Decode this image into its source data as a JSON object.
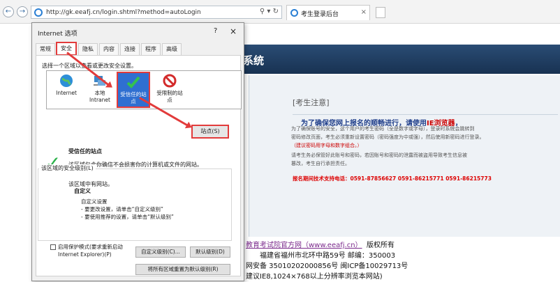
{
  "browser": {
    "url": "http://gk.eeafj.cn/login.shtml?method=autoLogin",
    "tools": "⚲ ▾ ↻",
    "tab_title": "考生登录后台",
    "back": "←",
    "forward": "→",
    "close": "×"
  },
  "page": {
    "header_title": "系统",
    "notice_title": "[考生注意]",
    "notice_head_prefix": "为了确保您网上报名的顺畅进行，请使用",
    "notice_head_hl": "IE浏览器",
    "notice_head_suffix": "，",
    "notice_lines": [
      "为了确保账号的安全，这个用户的考生密码（全是数字或字母），登录时系统会跳转到",
      "密码修改页面，考生必须重新设置密码（密码强度为中或强），然后使用新密码进行登录。",
      "（建议密码用字母和数字组合。）",
      "请考生务必保管好此账号和密码，若因账号和密码的泄露而被盗用导致考生信息被",
      "篡改，考生自行承担责任。"
    ],
    "support": "报名期间技术支持电话：0591-87856627   0591-86215771   0591-86215773",
    "footer_link": "教育考试院官方网（www.eeafj.cn）",
    "footer_rights": "版权所有",
    "footer_address": "福建省福州市北环中路59号  邮编：350003",
    "footer_icp": "网安备  35010202000856号 闽ICP备10029713号",
    "footer_tip": "建议IE8,1024×768以上分辨率浏览本网站)"
  },
  "dialog": {
    "title": "Internet 选项",
    "help": "?",
    "close": "×",
    "tabs": [
      "常规",
      "安全",
      "隐私",
      "内容",
      "连接",
      "程序",
      "高级"
    ],
    "active_tab": "安全",
    "select_zone_label": "选择一个区域以查看或更改安全设置。",
    "zones": [
      {
        "label": "Internet",
        "icon": "globe-icon"
      },
      {
        "label": "本地\nIntranet",
        "icon": "intranet-icon"
      },
      {
        "label": "受信任的站\n点",
        "icon": "check-icon"
      },
      {
        "label": "受限制的站\n点",
        "icon": "restricted-icon"
      }
    ],
    "selected_zone": "受信任的站点",
    "zone_name": "受信任的站点",
    "zone_desc": "该区域包含你确信不会损害你的计算机或文件的网站。",
    "zone_empty": "该区域中有网站。",
    "sites_button": "站点(S)",
    "level_group_title": "该区域的安全级别(L)",
    "custom_title": "自定义",
    "custom_lines": [
      "自定义设置",
      "- 要更改设置，请单击“自定义级别”",
      "- 要使用推荐的设置，请单击“默认级别”"
    ],
    "protected_mode_label": "启用保护模式(要求重新启动 Internet Explorer)(P)",
    "protected_mode_checked": false,
    "custom_level_button": "自定义级别(C)...",
    "default_level_button": "默认级别(D)",
    "reset_all_button": "将所有区域重置为默认级别(R)"
  },
  "colors": {
    "highlight_red": "#e23b3b",
    "selection_blue": "#2f6fd1",
    "header_navy": "#1e3a5c"
  }
}
